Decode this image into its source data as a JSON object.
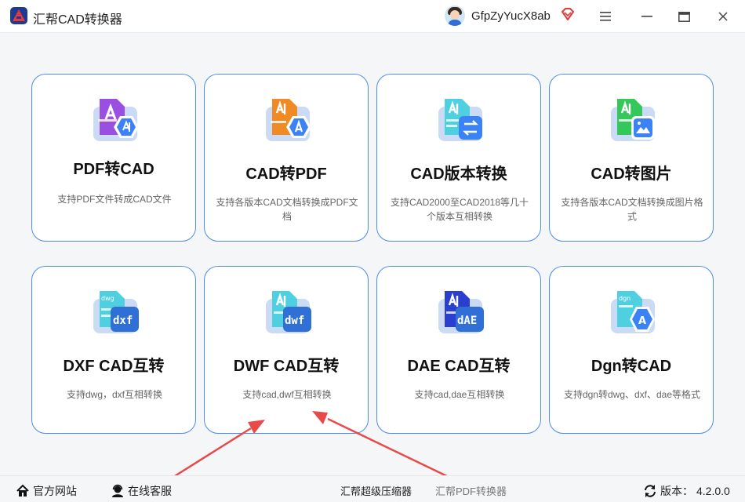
{
  "app": {
    "title": "汇帮CAD转换器",
    "username": "GfpZyYucX8ab"
  },
  "cards": [
    {
      "title": "PDF转CAD",
      "desc": "支持PDF文件转成CAD文件"
    },
    {
      "title": "CAD转PDF",
      "desc": "支持各版本CAD文档转换成PDF文档"
    },
    {
      "title": "CAD版本转换",
      "desc": "支持CAD2000至CAD2018等几十个版本互相转换"
    },
    {
      "title": "CAD转图片",
      "desc": "支持各版本CAD文档转换成图片格式"
    },
    {
      "title": "DXF CAD互转",
      "desc": "支持dwg，dxf互相转换",
      "badge": "dxf",
      "tag": "dwg"
    },
    {
      "title": "DWF CAD互转",
      "desc": "支持cad,dwf互相转换",
      "badge": "dwf"
    },
    {
      "title": "DAE CAD互转",
      "desc": "支持cad,dae互相转换",
      "badge": "dAE"
    },
    {
      "title": "Dgn转CAD",
      "desc": "支持dgn转dwg、dxf、dae等格式",
      "tag": "dgn",
      "badge": "A"
    }
  ],
  "footer": {
    "website": "官方网站",
    "support": "在线客服",
    "compressor": "汇帮超级压缩器",
    "pdf_converter": "汇帮PDF转换器",
    "version_label": "版本：",
    "version": "4.2.0.0"
  },
  "colors": {
    "accent": "#4d8af0",
    "arrow": "#e84a4a",
    "icon_blue": "#2f6fd6"
  }
}
